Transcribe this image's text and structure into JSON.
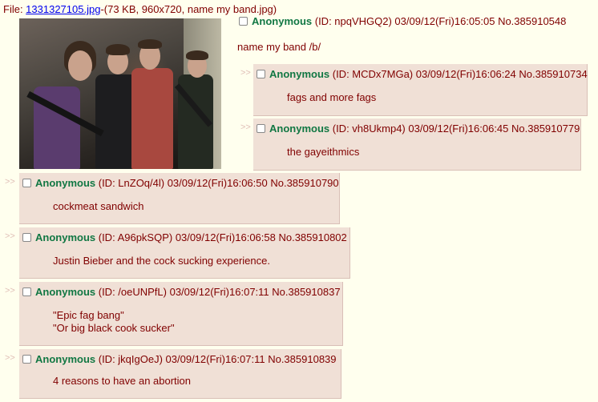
{
  "file": {
    "prefix": "File: ",
    "link": "1331327105.jpg",
    "meta": "-(73 KB, 960x720, name my band.jpg)"
  },
  "op": {
    "name": "Anonymous",
    "info": " (ID: npqVHGQ2) 03/09/12(Fri)16:05:05 No.385910548",
    "message": "name my band /b/"
  },
  "arrows": ">>",
  "replies": [
    {
      "name": "Anonymous",
      "info": " (ID: MCDx7MGa) 03/09/12(Fri)16:06:24 No.385910734",
      "lines": [
        "fags and more fags"
      ]
    },
    {
      "name": "Anonymous",
      "info": " (ID: vh8Ukmp4) 03/09/12(Fri)16:06:45 No.385910779",
      "lines": [
        "the gayeithmics"
      ]
    },
    {
      "name": "Anonymous",
      "info": " (ID: LnZOq/4l) 03/09/12(Fri)16:06:50 No.385910790",
      "lines": [
        "cockmeat sandwich"
      ]
    },
    {
      "name": "Anonymous",
      "info": " (ID: A96pkSQP) 03/09/12(Fri)16:06:58 No.385910802",
      "lines": [
        "Justin Bieber and the cock sucking experience."
      ]
    },
    {
      "name": "Anonymous",
      "info": " (ID: /oeUNPfL) 03/09/12(Fri)16:07:11 No.385910837",
      "lines": [
        "\"Epic fag bang\"",
        "\"Or big black cook sucker\""
      ]
    },
    {
      "name": "Anonymous",
      "info": " (ID: jkqIgOeJ) 03/09/12(Fri)16:07:11 No.385910839",
      "lines": [
        "4 reasons to have an abortion"
      ]
    }
  ],
  "colors": {
    "page_bg": "#ffffee",
    "post_bg": "#f0e0d6",
    "name": "#117743",
    "text": "#800000",
    "link": "#0000ee"
  }
}
